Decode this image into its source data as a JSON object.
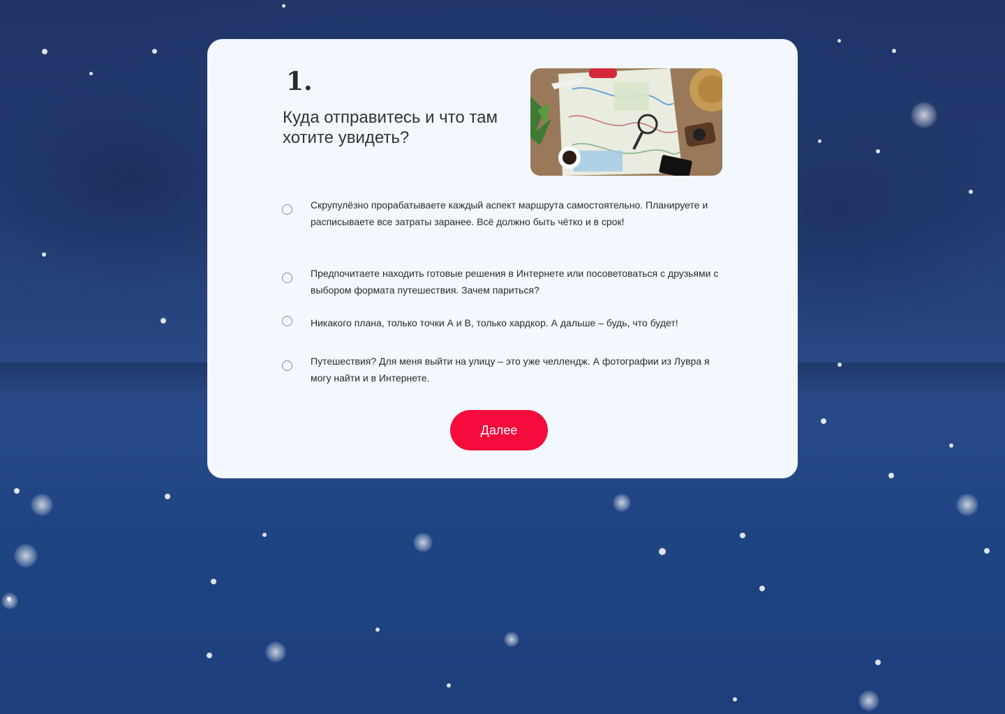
{
  "quiz": {
    "number": "1.",
    "question": "Куда отправитесь и что там хотите увидеть?",
    "image_icon": "travel-map-photo",
    "options": [
      {
        "label": "Скрупулёзно прорабатываете каждый аспект маршрута самостоятельно. Планируете и расписываете все затраты заранее. Всё должно быть чётко и в срок!"
      },
      {
        "label": "Предпочитаете находить готовые решения в Интернете или посоветоваться с друзьями с выбором формата путешествия. Зачем париться?"
      },
      {
        "label": "Никакого плана, только точки А и В, только хардкор. А дальше – будь, что будет!"
      },
      {
        "label": "Путешествия? Для меня выйти на улицу – это уже челлендж. А фотографии из Лувра я могу найти и в Интернете."
      }
    ],
    "next_label": "Далее"
  },
  "colors": {
    "card_background": "#f2f8fd",
    "accent": "#f50b3c",
    "background": "#243c72"
  }
}
